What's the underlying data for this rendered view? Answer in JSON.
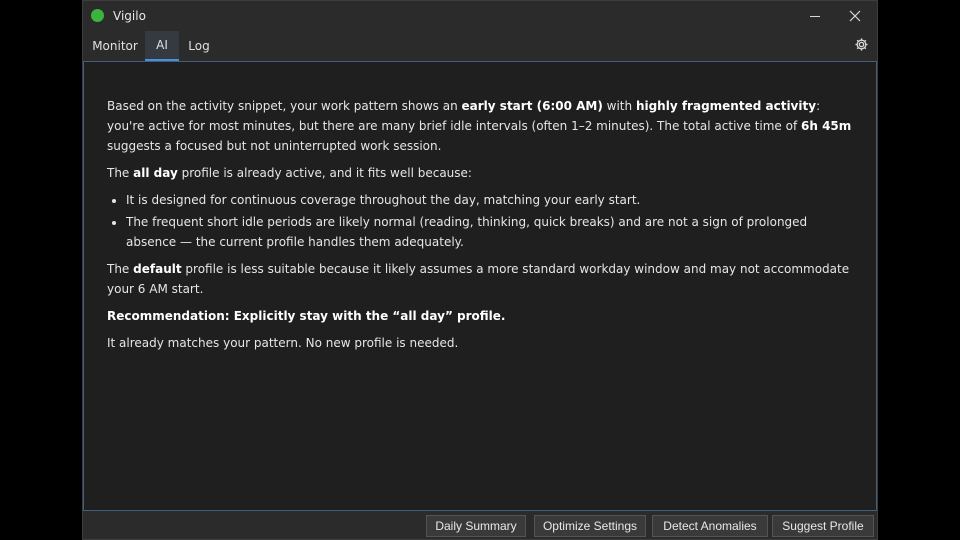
{
  "window": {
    "title": "Vigilo",
    "status_color": "#3cb33c"
  },
  "tabs": [
    {
      "label": "Monitor",
      "active": false
    },
    {
      "label": "AI",
      "active": true
    },
    {
      "label": "Log",
      "active": false
    }
  ],
  "analysis": {
    "p1": {
      "a": "Based on the activity snippet, your work pattern shows an ",
      "b1": "early start (6:00 AM)",
      "c": " with ",
      "b2": "highly fragmented activity",
      "d": ": you're active for most minutes, but there are many brief idle intervals (often 1–2 minutes). The total active time of ",
      "b3": "6h 45m",
      "e": " suggests a focused but not uninterrupted work session."
    },
    "p2": {
      "a": "The ",
      "b": "all day",
      "c": " profile is already active, and it fits well because:"
    },
    "bullets": [
      "It is designed for continuous coverage throughout the day, matching your early start.",
      "The frequent short idle periods are likely normal (reading, thinking, quick breaks) and are not a sign of prolonged absence — the current profile handles them adequately."
    ],
    "p3": {
      "a": "The ",
      "b": "default",
      "c": " profile is less suitable because it likely assumes a more standard workday window and may not accommodate your 6 AM start."
    },
    "recommendation": "Recommendation: Explicitly stay with the “all day” profile.",
    "recommendation_note": "It already matches your pattern. No new profile is needed."
  },
  "actions": {
    "daily_summary": "Daily Summary",
    "optimize_settings": "Optimize Settings",
    "detect_anomalies": "Detect Anomalies",
    "suggest_profile": "Suggest Profile"
  },
  "icons": {
    "minimize": "minimize-icon",
    "close": "close-icon",
    "settings": "gear-icon"
  }
}
